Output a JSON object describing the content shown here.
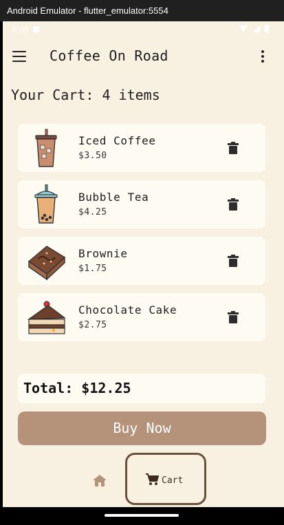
{
  "window": {
    "title": "Android Emulator - flutter_emulator:5554"
  },
  "status_bar": {
    "time": "6:00"
  },
  "app_bar": {
    "title": "Coffee On Road",
    "menu_icon": "menu-icon",
    "more_icon": "more-vert-icon"
  },
  "cart": {
    "heading": "Your Cart: 4 items",
    "items": [
      {
        "name": "Iced Coffee",
        "price": "$3.50",
        "icon": "iced-coffee-icon"
      },
      {
        "name": "Bubble Tea",
        "price": "$4.25",
        "icon": "bubble-tea-icon"
      },
      {
        "name": "Brownie",
        "price": "$1.75",
        "icon": "brownie-icon"
      },
      {
        "name": "Chocolate Cake",
        "price": "$2.75",
        "icon": "chocolate-cake-icon"
      }
    ],
    "total_label": "Total: $12.25",
    "buy_label": "Buy Now"
  },
  "bottom_nav": {
    "cart_label": "Cart"
  },
  "colors": {
    "background": "#f8f1e2",
    "card": "#fefbf3",
    "button": "#b5937a",
    "accent_border": "#6a4f3a"
  }
}
